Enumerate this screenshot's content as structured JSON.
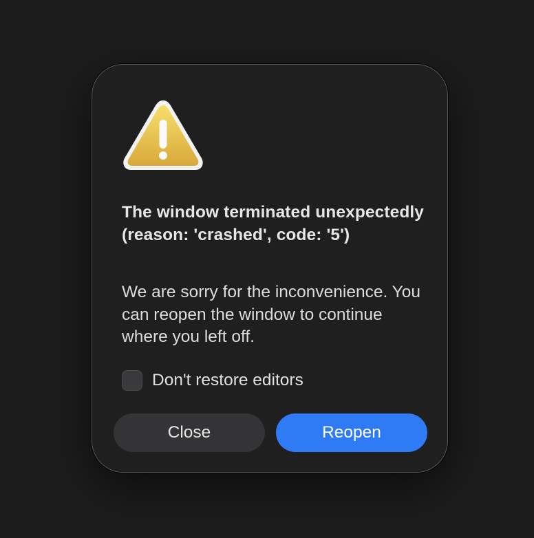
{
  "dialog": {
    "icon": "warning-triangle-icon",
    "title": "The window terminated unexpectedly (reason: 'crashed', code: '5')",
    "message": "We are sorry for the inconvenience. You can reopen the window to continue where you left off.",
    "checkbox": {
      "label": "Don't restore editors",
      "checked": false
    },
    "buttons": {
      "close": "Close",
      "reopen": "Reopen"
    }
  },
  "colors": {
    "background": "#1c1c1d",
    "dialog": "#1f1f20",
    "primary_button": "#2f7bf5",
    "secondary_button": "#343436",
    "warning_fill": "#e9c24a"
  }
}
